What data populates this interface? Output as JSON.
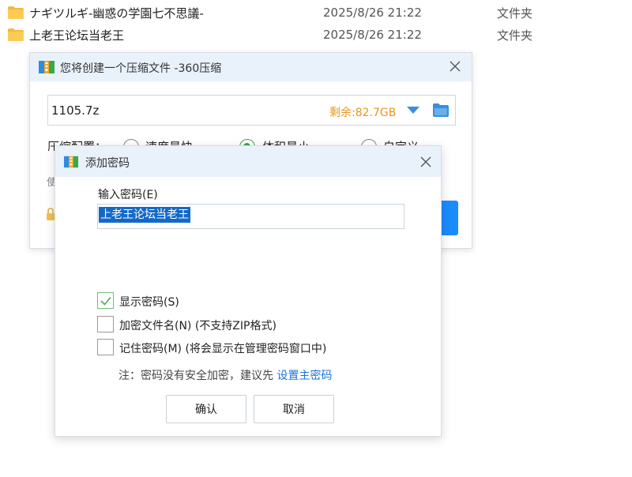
{
  "files": [
    {
      "name": "ナギツルギ-幽惑の学園七不思議-",
      "date": "2025/8/26 21:22",
      "type": "文件夹"
    },
    {
      "name": "上老王论坛当老王",
      "date": "2025/8/26 21:22",
      "type": "文件夹"
    }
  ],
  "compress_dialog": {
    "title": "您将创建一个压缩文件 -360压缩",
    "path": "1105.7z",
    "free_space": "剩余:82.7GB",
    "config_label": "压缩配置：",
    "options": [
      "速度最快",
      "体积最小",
      "自定义"
    ],
    "selected_option": "体积最小",
    "hint": "使"
  },
  "password_dialog": {
    "title": "添加密码",
    "input_label": "输入密码(E)",
    "password_value": "上老王论坛当老王",
    "show_password": {
      "label": "显示密码(S)",
      "checked": true
    },
    "encrypt_filenames": {
      "label": "加密文件名(N) (不支持ZIP格式)",
      "checked": false
    },
    "remember_password": {
      "label": "记住密码(M) (将会显示在管理密码窗口中)",
      "checked": false
    },
    "note_text": "注：密码没有安全加密，建议先 ",
    "note_link": "设置主密码",
    "ok_label": "确认",
    "cancel_label": "取消"
  },
  "colors": {
    "accent": "#1a8cff",
    "free_space": "#e8961e",
    "link": "#1a73d9",
    "selection": "#1469c7",
    "titlebar": "#e9f1fb"
  }
}
